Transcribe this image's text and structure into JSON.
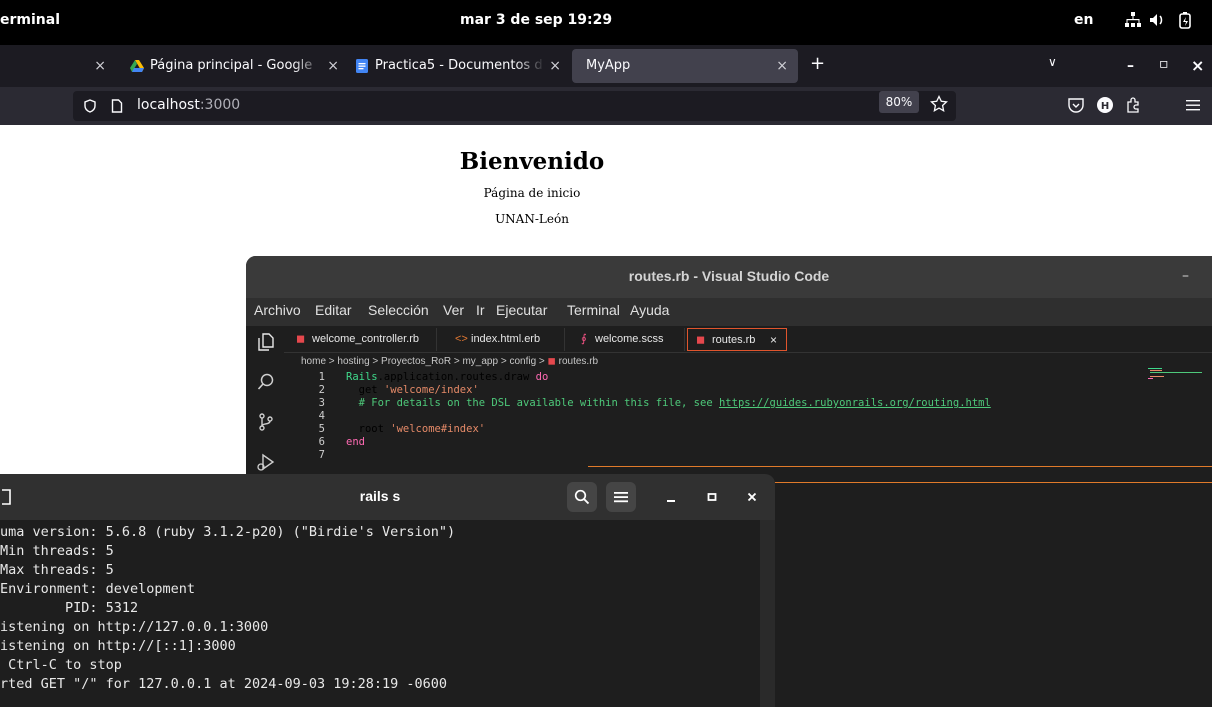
{
  "topbar": {
    "app_name": "erminal",
    "clock": "mar  3 de sep  19:29",
    "lang": "en",
    "icons": [
      "network-icon",
      "volume-icon",
      "battery-icon"
    ]
  },
  "browser": {
    "tabs": [
      {
        "title": "",
        "close": "×",
        "icon": "none"
      },
      {
        "title": "Página principal - Google",
        "close": "×",
        "icon": "google-drive-icon"
      },
      {
        "title": "Practica5 - Documentos d",
        "close": "×",
        "icon": "google-docs-icon"
      },
      {
        "title": "MyApp",
        "close": "×",
        "icon": "none",
        "active": true
      }
    ],
    "new_tab": "+",
    "tab_list": "∨",
    "window_controls": {
      "minimize": "–",
      "maximize": "▫",
      "close": "×"
    },
    "url_host": "localhost",
    "url_port": ":3000",
    "zoom": "80%"
  },
  "page": {
    "title": "Bienvenido",
    "subtitle": "Página de inicio",
    "org": "UNAN-León"
  },
  "vscode": {
    "title": "routes.rb - Visual Studio Code",
    "minimize": "–",
    "menu": [
      "Archivo",
      "Editar",
      "Selección",
      "Ver",
      "Ir",
      "Ejecutar",
      "Terminal",
      "Ayuda"
    ],
    "tabs": [
      {
        "name": "welcome_controller.rb",
        "icon": "◼",
        "icon_color": "#e5484d"
      },
      {
        "name": "index.html.erb",
        "icon": "<>",
        "icon_color": "#e37933"
      },
      {
        "name": "welcome.scss",
        "icon": "∮",
        "icon_color": "#f55385"
      },
      {
        "name": "routes.rb",
        "icon": "◼",
        "icon_color": "#e5484d",
        "active": true,
        "close": "×"
      }
    ],
    "breadcrumb": "home > hosting > Proyectos_RoR > my_app > config > ",
    "breadcrumb_file": "routes.rb",
    "code": [
      {
        "n": "1",
        "parts": [
          [
            "cls",
            "Rails"
          ],
          [
            "",
            ".application.routes.draw "
          ],
          [
            "kw",
            "do"
          ]
        ]
      },
      {
        "n": "2",
        "parts": [
          [
            "",
            "  get "
          ],
          [
            "str",
            "'welcome/index'"
          ]
        ]
      },
      {
        "n": "3",
        "parts": [
          [
            "cm",
            "  # For details on the DSL available within this file, see "
          ],
          [
            "link",
            "https://guides.rubyonrails.org/routing.html"
          ]
        ]
      },
      {
        "n": "4",
        "parts": [
          [
            "",
            ""
          ]
        ]
      },
      {
        "n": "5",
        "parts": [
          [
            "",
            "  root "
          ],
          [
            "str",
            "'welcome#index'"
          ]
        ]
      },
      {
        "n": "6",
        "parts": [
          [
            "kw",
            "end"
          ]
        ]
      },
      {
        "n": "7",
        "parts": [
          [
            "",
            ""
          ]
        ]
      }
    ]
  },
  "terminal": {
    "title": "rails s",
    "lines": [
      "uma version: 5.6.8 (ruby 3.1.2-p20) (\"Birdie's Version\")",
      "Min threads: 5",
      "Max threads: 5",
      "Environment: development",
      "        PID: 5312",
      "istening on http://127.0.0.1:3000",
      "istening on http://[::1]:3000",
      " Ctrl-C to stop",
      "rted GET \"/\" for 127.0.0.1 at 2024-09-03 19:28:19 -0600"
    ]
  }
}
